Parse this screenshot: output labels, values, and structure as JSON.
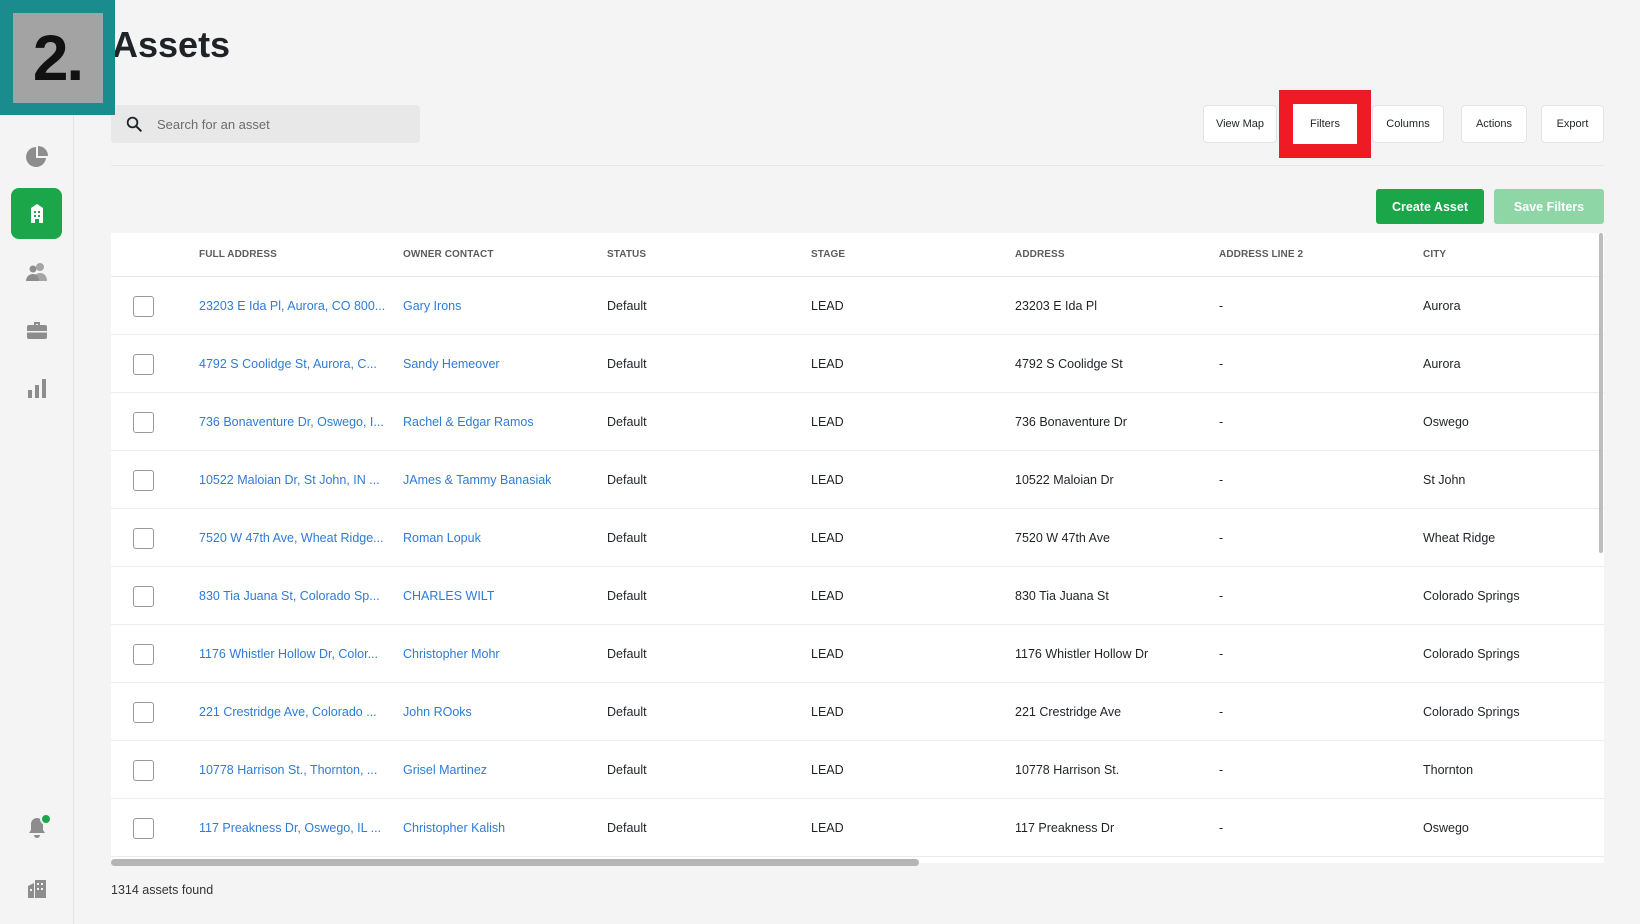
{
  "step_badge": "2.",
  "page": {
    "title": "Assets"
  },
  "search": {
    "placeholder": "Search for an asset",
    "value": ""
  },
  "toolbar": {
    "view_map": "View Map",
    "filters": "Filters",
    "columns": "Columns",
    "actions": "Actions",
    "export": "Export"
  },
  "actions": {
    "create_asset": "Create Asset",
    "save_filters": "Save Filters"
  },
  "colors": {
    "accent": "#1ca64a",
    "accent_disabled": "#8fd6a7",
    "link": "#2f7bd6",
    "highlight": "#ee1b24",
    "badge": "#1a8c8e"
  },
  "sidebar": {
    "items": [
      {
        "icon": "pie-chart-icon",
        "active": false
      },
      {
        "icon": "building-icon",
        "active": true
      },
      {
        "icon": "contacts-icon",
        "active": false
      },
      {
        "icon": "briefcase-icon",
        "active": false
      },
      {
        "icon": "bar-chart-icon",
        "active": false
      }
    ],
    "bottom": [
      {
        "icon": "bell-icon"
      },
      {
        "icon": "organization-icon"
      }
    ]
  },
  "table": {
    "columns": [
      "FULL ADDRESS",
      "OWNER CONTACT",
      "STATUS",
      "STAGE",
      "ADDRESS",
      "ADDRESS LINE 2",
      "CITY"
    ],
    "rows": [
      {
        "full_address": "23203 E Ida Pl, Aurora, CO 800...",
        "owner": "Gary Irons",
        "status": "Default",
        "stage": "LEAD",
        "address": "23203 E Ida Pl",
        "line2": "-",
        "city": "Aurora"
      },
      {
        "full_address": "4792 S Coolidge St, Aurora, C...",
        "owner": "Sandy Hemeover",
        "status": "Default",
        "stage": "LEAD",
        "address": "4792 S Coolidge St",
        "line2": "-",
        "city": "Aurora"
      },
      {
        "full_address": "736 Bonaventure Dr, Oswego, I...",
        "owner": "Rachel & Edgar Ramos",
        "status": "Default",
        "stage": "LEAD",
        "address": "736 Bonaventure Dr",
        "line2": "-",
        "city": "Oswego"
      },
      {
        "full_address": "10522 Maloian Dr, St John, IN ...",
        "owner": "JAmes & Tammy Banasiak",
        "status": "Default",
        "stage": "LEAD",
        "address": "10522 Maloian Dr",
        "line2": "-",
        "city": "St John"
      },
      {
        "full_address": "7520 W 47th Ave, Wheat Ridge...",
        "owner": "Roman Lopuk",
        "status": "Default",
        "stage": "LEAD",
        "address": "7520 W 47th Ave",
        "line2": "-",
        "city": "Wheat Ridge"
      },
      {
        "full_address": "830 Tia Juana St, Colorado Sp...",
        "owner": "CHARLES WILT",
        "status": "Default",
        "stage": "LEAD",
        "address": "830 Tia Juana St",
        "line2": "-",
        "city": "Colorado Springs"
      },
      {
        "full_address": "1176 Whistler Hollow Dr, Color...",
        "owner": "Christopher Mohr",
        "status": "Default",
        "stage": "LEAD",
        "address": "1176 Whistler Hollow Dr",
        "line2": "-",
        "city": "Colorado Springs"
      },
      {
        "full_address": "221 Crestridge Ave, Colorado ...",
        "owner": "John ROoks",
        "status": "Default",
        "stage": "LEAD",
        "address": "221 Crestridge Ave",
        "line2": "-",
        "city": "Colorado Springs"
      },
      {
        "full_address": "10778 Harrison St., Thornton, ...",
        "owner": "Grisel Martinez",
        "status": "Default",
        "stage": "LEAD",
        "address": "10778 Harrison St.",
        "line2": "-",
        "city": "Thornton"
      },
      {
        "full_address": "117 Preakness Dr, Oswego, IL ...",
        "owner": "Christopher Kalish",
        "status": "Default",
        "stage": "LEAD",
        "address": "117 Preakness Dr",
        "line2": "-",
        "city": "Oswego"
      }
    ]
  },
  "footer": {
    "count": "1314 assets found"
  }
}
